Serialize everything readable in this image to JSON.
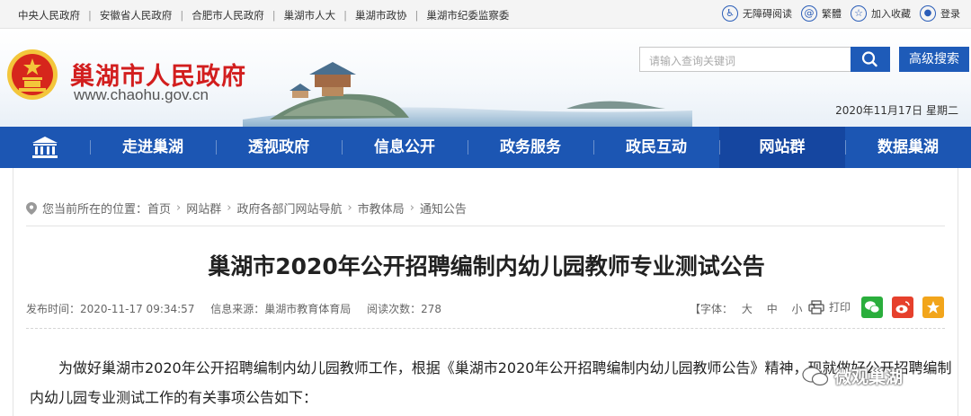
{
  "topbar": {
    "links": [
      "中央人民政府",
      "安徽省人民政府",
      "合肥市人民政府",
      "巢湖市人大",
      "巢湖市政协",
      "巢湖市纪委监察委"
    ],
    "accessibility": "无障碍阅读",
    "traditional": "繁體",
    "favorite": "加入收藏",
    "login": "登录"
  },
  "header": {
    "site_title": "巢湖市人民政府",
    "site_url": "www.chaohu.gov.cn",
    "search_placeholder": "请输入查询关键词",
    "advanced_search": "高级搜索",
    "date": "2020年11月17日 星期二"
  },
  "nav": {
    "items": [
      "走进巢湖",
      "透视政府",
      "信息公开",
      "政务服务",
      "政民互动",
      "网站群",
      "数据巢湖"
    ],
    "active_index": 5
  },
  "breadcrumb": {
    "prefix": "您当前所在的位置：",
    "items": [
      "首页",
      "网站群",
      "政府各部门网站导航",
      "市教体局",
      "通知公告"
    ]
  },
  "article": {
    "title": "巢湖市2020年公开招聘编制内幼儿园教师专业测试公告",
    "publish_time": "发布时间：2020-11-17 09:34:57",
    "source": "信息来源：巢湖市教育体育局",
    "views": "阅读次数：278",
    "font_size_label": "【字体：",
    "font_sizes": [
      "大",
      "中",
      "小"
    ],
    "font_size_close": "】",
    "print": "打印",
    "paragraph": "为做好巢湖市2020年公开招聘编制内幼儿园教师工作，根据《巢湖市2020年公开招聘编制内幼儿园教师公告》精神，现就做好公开招聘编制内幼儿园专业测试工作的有关事项公告如下："
  },
  "watermark": "微观巢湖",
  "colors": {
    "nav_blue": "#1c56b3",
    "title_red": "#d21e1e",
    "wechat_green": "#2aae3c",
    "weibo_red": "#e6402c",
    "qzone_yellow": "#f2a51b"
  }
}
